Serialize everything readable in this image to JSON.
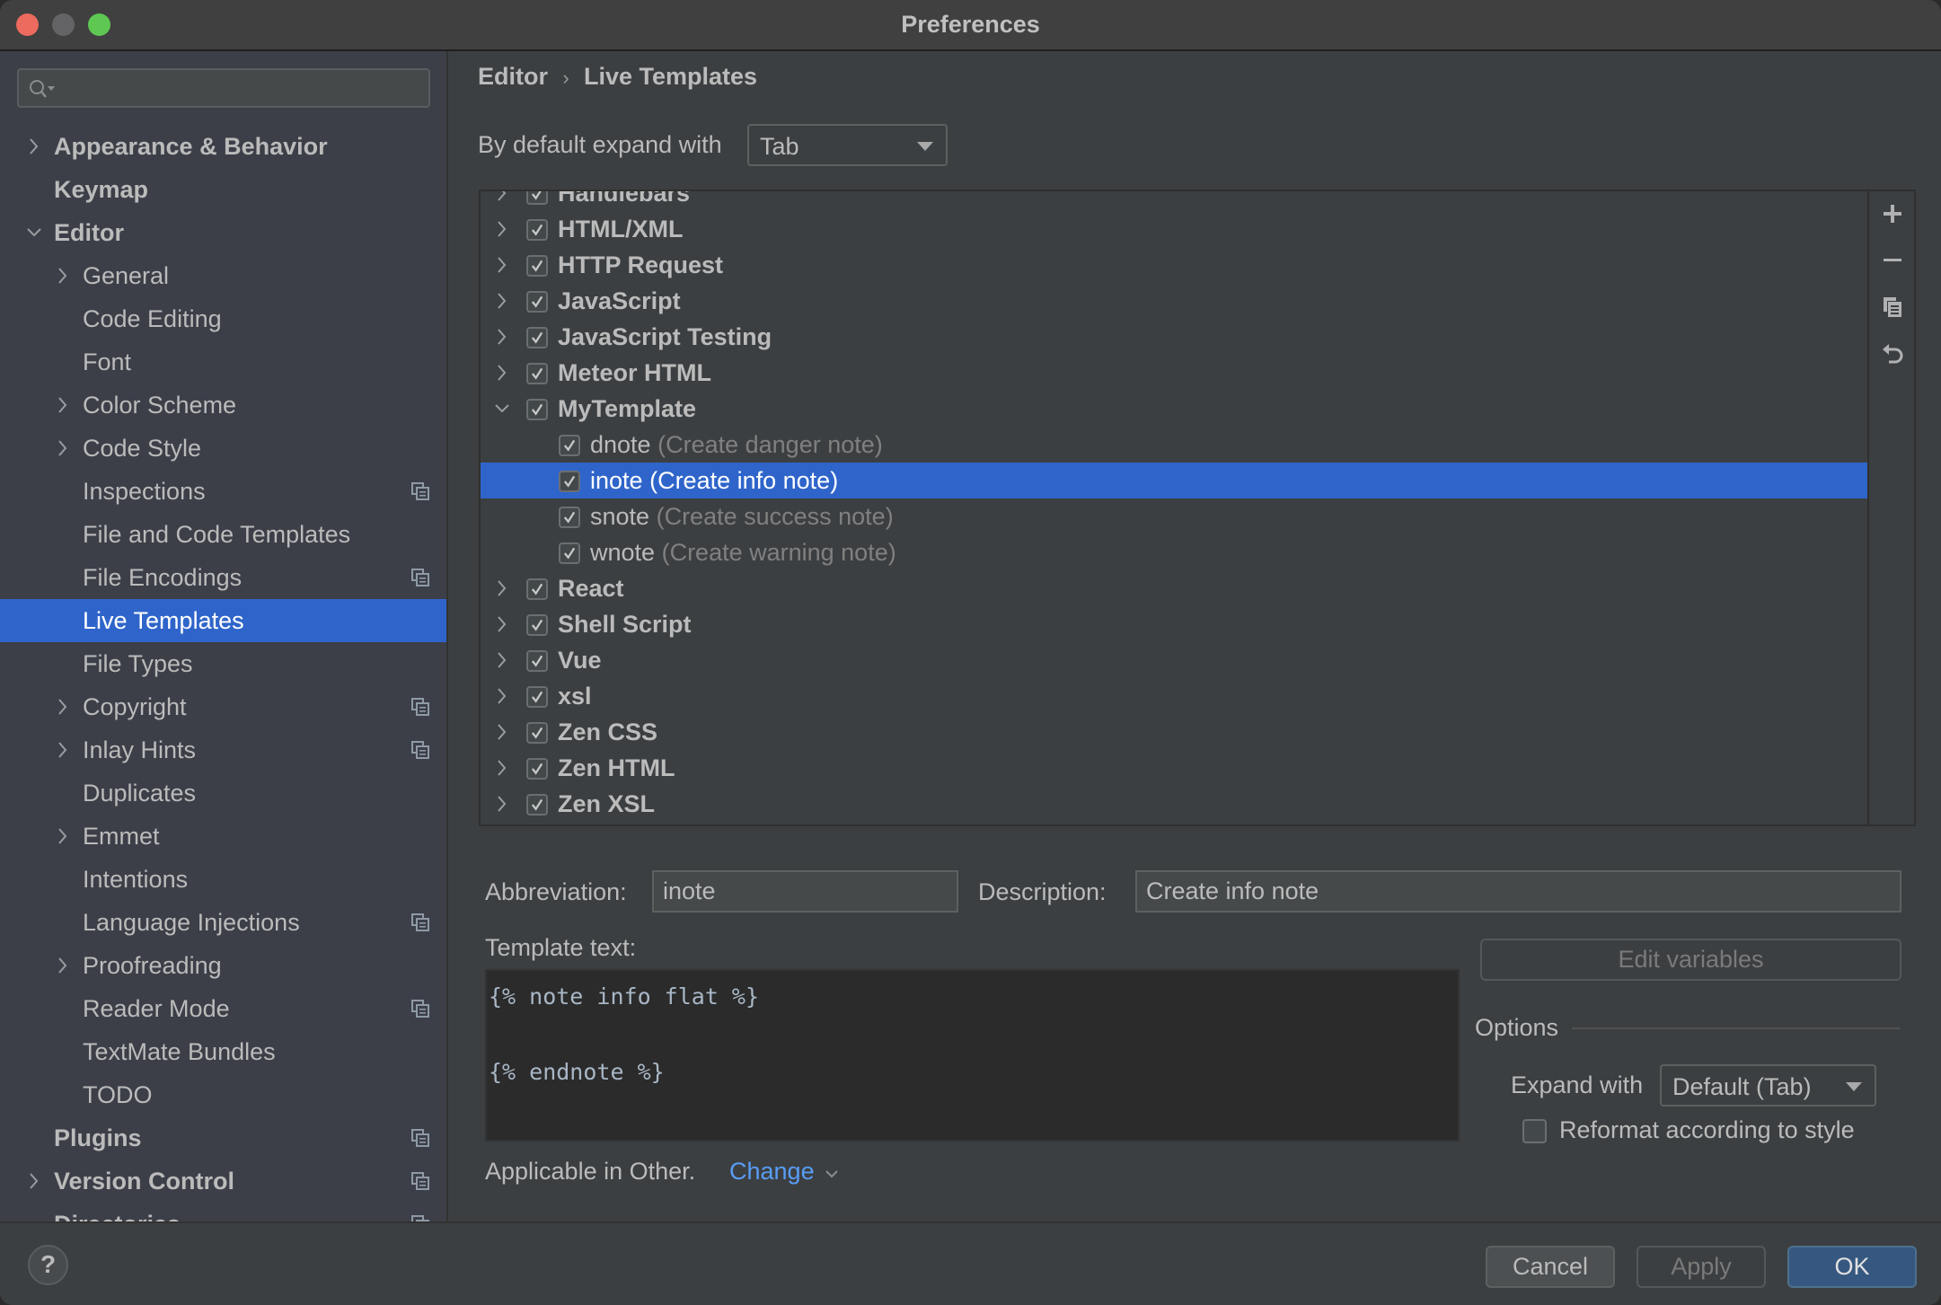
{
  "window": {
    "title": "Preferences"
  },
  "sidebar": {
    "search": {
      "value": "",
      "placeholder": ""
    },
    "items": [
      {
        "label": "Appearance & Behavior",
        "level": 0,
        "bold": true,
        "expandable": true,
        "expanded": false,
        "project_icon": false
      },
      {
        "label": "Keymap",
        "level": 0,
        "bold": true,
        "expandable": false,
        "project_icon": false
      },
      {
        "label": "Editor",
        "level": 0,
        "bold": true,
        "expandable": true,
        "expanded": true,
        "project_icon": false
      },
      {
        "label": "General",
        "level": 1,
        "expandable": true,
        "expanded": false,
        "project_icon": false
      },
      {
        "label": "Code Editing",
        "level": 1,
        "expandable": false,
        "project_icon": false
      },
      {
        "label": "Font",
        "level": 1,
        "expandable": false,
        "project_icon": false
      },
      {
        "label": "Color Scheme",
        "level": 1,
        "expandable": true,
        "expanded": false,
        "project_icon": false
      },
      {
        "label": "Code Style",
        "level": 1,
        "expandable": true,
        "expanded": false,
        "project_icon": false
      },
      {
        "label": "Inspections",
        "level": 1,
        "expandable": false,
        "project_icon": true
      },
      {
        "label": "File and Code Templates",
        "level": 1,
        "expandable": false,
        "project_icon": false
      },
      {
        "label": "File Encodings",
        "level": 1,
        "expandable": false,
        "project_icon": true
      },
      {
        "label": "Live Templates",
        "level": 1,
        "expandable": false,
        "project_icon": false,
        "selected": true
      },
      {
        "label": "File Types",
        "level": 1,
        "expandable": false,
        "project_icon": false
      },
      {
        "label": "Copyright",
        "level": 1,
        "expandable": true,
        "expanded": false,
        "project_icon": true
      },
      {
        "label": "Inlay Hints",
        "level": 1,
        "expandable": true,
        "expanded": false,
        "project_icon": true
      },
      {
        "label": "Duplicates",
        "level": 1,
        "expandable": false,
        "project_icon": false
      },
      {
        "label": "Emmet",
        "level": 1,
        "expandable": true,
        "expanded": false,
        "project_icon": false
      },
      {
        "label": "Intentions",
        "level": 1,
        "expandable": false,
        "project_icon": false
      },
      {
        "label": "Language Injections",
        "level": 1,
        "expandable": false,
        "project_icon": true
      },
      {
        "label": "Proofreading",
        "level": 1,
        "expandable": true,
        "expanded": false,
        "project_icon": false
      },
      {
        "label": "Reader Mode",
        "level": 1,
        "expandable": false,
        "project_icon": true
      },
      {
        "label": "TextMate Bundles",
        "level": 1,
        "expandable": false,
        "project_icon": false
      },
      {
        "label": "TODO",
        "level": 1,
        "expandable": false,
        "project_icon": false
      },
      {
        "label": "Plugins",
        "level": 0,
        "bold": true,
        "expandable": false,
        "project_icon": true
      },
      {
        "label": "Version Control",
        "level": 0,
        "bold": true,
        "expandable": true,
        "expanded": false,
        "project_icon": true
      },
      {
        "label": "Directories",
        "level": 0,
        "bold": true,
        "expandable": false,
        "project_icon": true
      }
    ]
  },
  "main": {
    "breadcrumb": [
      "Editor",
      "Live Templates"
    ],
    "breadcrumb_separator": "›",
    "default_expand": {
      "label": "By default expand with",
      "value": "Tab"
    },
    "template_groups": [
      {
        "name": "Handlebars",
        "checked": true,
        "expanded": false
      },
      {
        "name": "HTML/XML",
        "checked": true,
        "expanded": false
      },
      {
        "name": "HTTP Request",
        "checked": true,
        "expanded": false
      },
      {
        "name": "JavaScript",
        "checked": true,
        "expanded": false
      },
      {
        "name": "JavaScript Testing",
        "checked": true,
        "expanded": false
      },
      {
        "name": "Meteor HTML",
        "checked": true,
        "expanded": false
      },
      {
        "name": "MyTemplate",
        "checked": true,
        "expanded": true,
        "templates": [
          {
            "abbr": "dnote",
            "desc": "(Create danger note)",
            "checked": true
          },
          {
            "abbr": "inote",
            "desc": "(Create info note)",
            "checked": true,
            "selected": true
          },
          {
            "abbr": "snote",
            "desc": "(Create success note)",
            "checked": true
          },
          {
            "abbr": "wnote",
            "desc": "(Create warning note)",
            "checked": true
          }
        ]
      },
      {
        "name": "React",
        "checked": true,
        "expanded": false
      },
      {
        "name": "Shell Script",
        "checked": true,
        "expanded": false
      },
      {
        "name": "Vue",
        "checked": true,
        "expanded": false
      },
      {
        "name": "xsl",
        "checked": true,
        "expanded": false
      },
      {
        "name": "Zen CSS",
        "checked": true,
        "expanded": false
      },
      {
        "name": "Zen HTML",
        "checked": true,
        "expanded": false
      },
      {
        "name": "Zen XSL",
        "checked": true,
        "expanded": false
      }
    ],
    "toolbar": [
      {
        "name": "add-icon",
        "title": "Add"
      },
      {
        "name": "remove-icon",
        "title": "Remove"
      },
      {
        "name": "duplicate-icon",
        "title": "Duplicate"
      },
      {
        "name": "restore-icon",
        "title": "Restore"
      }
    ],
    "editor": {
      "abbreviation_label": "Abbreviation:",
      "abbreviation_value": "inote",
      "description_label": "Description:",
      "description_value": "Create info note",
      "template_text_label": "Template text:",
      "template_text": "{% note info flat %}\n\n{% endnote %}",
      "edit_variables_label": "Edit variables",
      "options_label": "Options",
      "expand_with_label": "Expand with",
      "expand_with_value": "Default (Tab)",
      "reformat_label": "Reformat according to style",
      "reformat_checked": false,
      "applicable_text": "Applicable in Other.",
      "change_link": "Change"
    }
  },
  "footer": {
    "help_label": "?",
    "cancel_label": "Cancel",
    "apply_label": "Apply",
    "ok_label": "OK"
  },
  "colors": {
    "selection": "#2f65ca",
    "link": "#589df6",
    "ok_button": "#365880"
  }
}
